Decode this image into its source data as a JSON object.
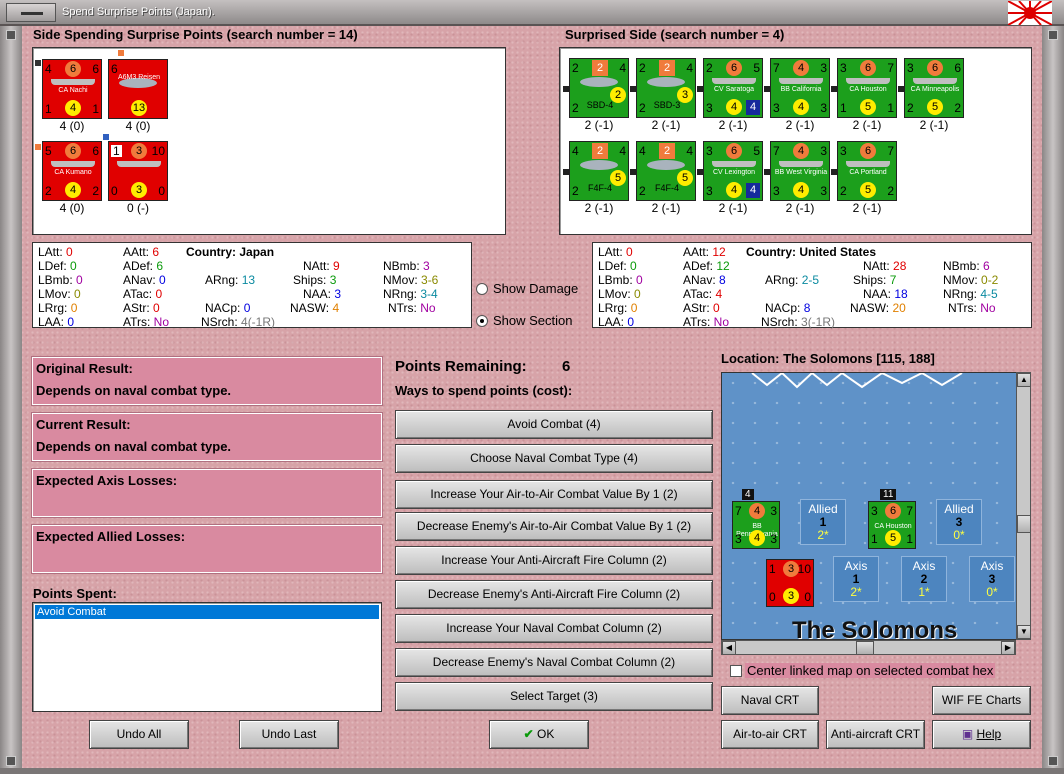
{
  "window": {
    "title": "Spend Surprise Points (Japan)."
  },
  "colors": {
    "background": "#d7a3a8",
    "japan_counter": "#e00000",
    "allied_counter": "#1c9f1c",
    "pink_panel": "#d98aa0",
    "selection": "#0078d7",
    "sea": "#5f92c8"
  },
  "spending": {
    "title": "Side Spending Surprise Points (search number = 14)",
    "counters": [
      {
        "name": "CA Nachi",
        "tl": "4",
        "tr": "6",
        "oc": "6",
        "yc": "4",
        "bl": "1",
        "br": "1",
        "cap": "4 (0)"
      },
      {
        "name": "A6M3 Reisen",
        "tl": "6",
        "tr": "",
        "oc": "",
        "yc": "13",
        "bl": "",
        "br": "",
        "cap": "4 (0)"
      },
      {
        "name": "CA Kumano",
        "tl": "5",
        "tr": "6",
        "oc": "6",
        "yc": "4",
        "bl": "2",
        "br": "2",
        "cap": "4 (0)"
      },
      {
        "name": "",
        "tl": "1",
        "tr": "10",
        "oc": "3",
        "yc": "3",
        "bl": "0",
        "br": "0",
        "cap": "0 (-)"
      }
    ]
  },
  "surprised": {
    "title": "Surprised Side (search number = 4)",
    "counters": [
      {
        "name": "SBD-4",
        "tl": "2",
        "tr": "4",
        "sq": "2",
        "yc": "2",
        "bl": "2",
        "br": "",
        "cap": "2 (-1)"
      },
      {
        "name": "SBD-3",
        "tl": "2",
        "tr": "4",
        "sq": "2",
        "yc": "3",
        "bl": "2",
        "br": "",
        "cap": "2 (-1)"
      },
      {
        "name": "CV Saratoga",
        "tl": "2",
        "tr": "5",
        "oc": "6",
        "yc": "4",
        "bl": "3",
        "br": "4",
        "cap": "2 (-1)"
      },
      {
        "name": "BB California",
        "tl": "7",
        "tr": "3",
        "oc": "4",
        "yc": "4",
        "bl": "3",
        "br": "3",
        "cap": "2 (-1)"
      },
      {
        "name": "CA Houston",
        "tl": "3",
        "tr": "7",
        "oc": "6",
        "yc": "5",
        "bl": "1",
        "br": "1",
        "cap": "2 (-1)"
      },
      {
        "name": "CA Minneapolis",
        "tl": "3",
        "tr": "6",
        "oc": "6",
        "yc": "5",
        "bl": "2",
        "br": "2",
        "cap": "2 (-1)"
      },
      {
        "name": "F4F-4",
        "tl": "4",
        "tr": "4",
        "sq": "2",
        "yc": "5",
        "bl": "2",
        "br": "",
        "cap": "2 (-1)"
      },
      {
        "name": "F4F-4",
        "tl": "4",
        "tr": "4",
        "sq": "2",
        "yc": "5",
        "bl": "2",
        "br": "",
        "cap": "2 (-1)"
      },
      {
        "name": "CV Lexington",
        "tl": "3",
        "tr": "5",
        "oc": "6",
        "yc": "4",
        "bl": "3",
        "br": "4",
        "cap": "2 (-1)"
      },
      {
        "name": "BB West Virginia",
        "tl": "7",
        "tr": "3",
        "oc": "4",
        "yc": "4",
        "bl": "3",
        "br": "3",
        "cap": "2 (-1)"
      },
      {
        "name": "CA Portland",
        "tl": "3",
        "tr": "7",
        "oc": "6",
        "yc": "5",
        "bl": "2",
        "br": "2",
        "cap": "2 (-1)"
      }
    ]
  },
  "stats_left": {
    "country_label": "Country:",
    "country": "Japan",
    "LAtt": "0",
    "LDef": "0",
    "LBmb": "0",
    "LMov": "0",
    "LRrg": "0",
    "LAA": "0",
    "AAtt": "6",
    "ADef": "6",
    "ANav": "0",
    "ATac": "0",
    "AStr": "0",
    "ATrs": "No",
    "ARng": "13",
    "NACp": "0",
    "NSrch": "4(-1R)",
    "NAtt": "9",
    "Ships": "3",
    "NAA": "3",
    "NASW": "4",
    "NBmb": "3",
    "NMov": "3-6",
    "NRng": "3-4",
    "NTrs": "No"
  },
  "stats_right": {
    "country_label": "Country:",
    "country": "United States",
    "LAtt": "0",
    "LDef": "0",
    "LBmb": "0",
    "LMov": "0",
    "LRrg": "0",
    "LAA": "0",
    "AAtt": "12",
    "ADef": "12",
    "ANav": "8",
    "ATac": "4",
    "AStr": "0",
    "ATrs": "No",
    "ARng": "2-5",
    "NACp": "8",
    "NSrch": "3(-1R)",
    "NAtt": "28",
    "Ships": "7",
    "NAA": "18",
    "NASW": "20",
    "NBmb": "6",
    "NMov": "0-2",
    "NRng": "4-5",
    "NTrs": "No"
  },
  "options": {
    "show_damage": "Show Damage",
    "show_section": "Show Section"
  },
  "results": {
    "original_label": "Original Result:",
    "original_value": "Depends on naval combat type.",
    "current_label": "Current Result:",
    "current_value": "Depends on naval combat type.",
    "axis_losses_label": "Expected Axis Losses:",
    "allied_losses_label": "Expected Allied Losses:"
  },
  "points": {
    "spent_label": "Points Spent:",
    "spent_items": [
      "Avoid Combat"
    ],
    "remaining_label": "Points Remaining:",
    "remaining_value": "6",
    "ways_label": "Ways to spend points (cost):"
  },
  "actions": [
    "Avoid Combat (4)",
    "Choose Naval Combat Type (4)",
    "Increase Your Air-to-Air Combat Value By 1 (2)",
    "Decrease Enemy's Air-to-Air Combat Value By 1 (2)",
    "Increase Your Anti-Aircraft Fire Column (2)",
    "Decrease Enemy's Anti-Aircraft Fire Column (2)",
    "Increase Your Naval Combat Column (2)",
    "Decrease Enemy's Naval Combat Column (2)",
    "Select Target (3)"
  ],
  "buttons": {
    "undo_all": "Undo All",
    "undo_last": "Undo Last",
    "ok": "OK",
    "naval_crt": "Naval CRT",
    "wif_charts": "WIF FE Charts",
    "air_crt": "Air-to-air CRT",
    "aa_crt": "Anti-aircraft CRT",
    "help": "Help"
  },
  "map": {
    "location": "Location: The Solomons [115, 188]",
    "map_label": "The Solomons",
    "center_checkbox": "Center linked map on selected combat hex",
    "allied_boxes": [
      {
        "side": "Allied",
        "num": "1",
        "val": "2*"
      },
      {
        "side": "Allied",
        "num": "3",
        "val": "0*"
      }
    ],
    "axis_boxes": [
      {
        "side": "Axis",
        "num": "1",
        "val": "2*"
      },
      {
        "side": "Axis",
        "num": "2",
        "val": "1*"
      },
      {
        "side": "Axis",
        "num": "3",
        "val": "0*"
      }
    ],
    "stack_counts": [
      "4",
      "11"
    ],
    "counters": [
      {
        "name": "BB Pennsylvania",
        "tl": "7",
        "tr": "3",
        "oc": "4",
        "yc": "4",
        "bl": "3",
        "br": "3"
      },
      {
        "name": "CA Houston",
        "tl": "3",
        "tr": "7",
        "oc": "6",
        "yc": "5",
        "bl": "1",
        "br": "1"
      },
      {
        "name": "",
        "tl": "1",
        "tr": "10",
        "oc": "3",
        "yc": "3",
        "bl": "0",
        "br": "0"
      }
    ]
  }
}
